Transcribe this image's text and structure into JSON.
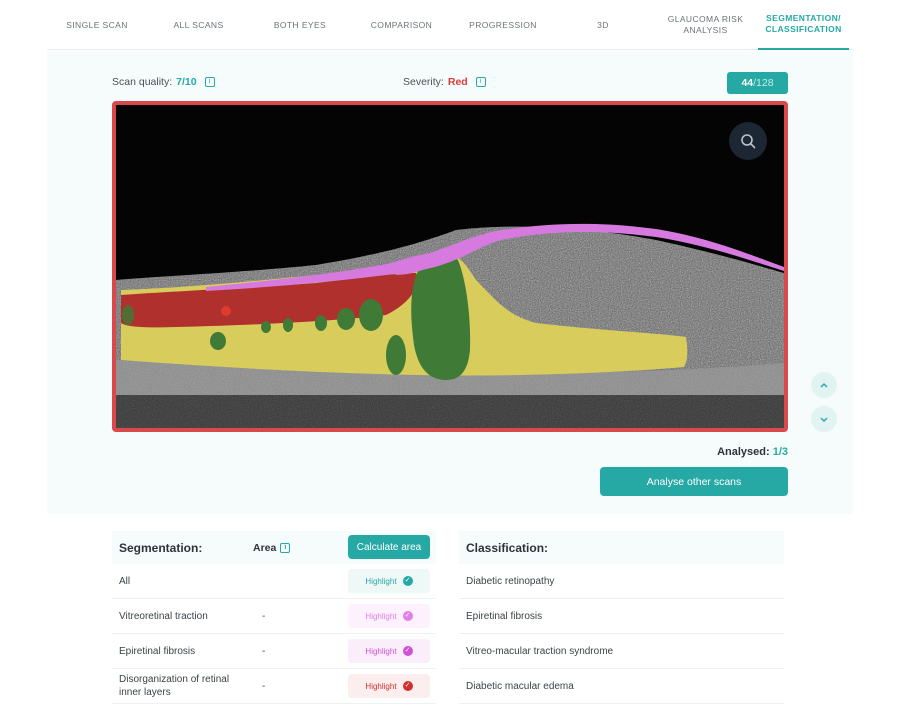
{
  "tabs": [
    {
      "label": "SINGLE SCAN",
      "active": false
    },
    {
      "label": "All SCANS",
      "active": false
    },
    {
      "label": "BOTH EYES",
      "active": false
    },
    {
      "label": "COMPARISON",
      "active": false
    },
    {
      "label": "PROGRESSION",
      "active": false
    },
    {
      "label": "3D",
      "active": false
    },
    {
      "label": "GLAUCOMA RISK ANALYSIS",
      "active": false
    },
    {
      "label": "SEGMENTATION/ CLASSIFICATION",
      "active": true
    }
  ],
  "scan": {
    "quality_label": "Scan quality:",
    "quality_value": "7/10",
    "severity_label": "Severity:",
    "severity_value": "Red",
    "current": "44",
    "total": "/128",
    "zoom_icon": "search-icon",
    "nav_up_icon": "chevron-up-icon",
    "nav_down_icon": "chevron-down-icon"
  },
  "analysis": {
    "analysed_label": "Analysed:",
    "analysed_value": "1/3",
    "button_label": "Analyse other scans"
  },
  "segmentation": {
    "title": "Segmentation:",
    "area_label": "Area",
    "calc_button": "Calculate area",
    "rows": [
      {
        "name": "All",
        "area": "",
        "highlight": "Highlight",
        "color": "#26a9a4",
        "bg": "#eef8f7"
      },
      {
        "name": "Vitreoretinal traction",
        "area": "-",
        "highlight": "Highlight",
        "color": "#e47ee8",
        "bg": "#fcf1fc"
      },
      {
        "name": "Epiretinal fibrosis",
        "area": "-",
        "highlight": "Highlight",
        "color": "#cf4fd6",
        "bg": "#fbeefb"
      },
      {
        "name": "Disorganization of retinal inner layers",
        "area": "-",
        "highlight": "Highlight",
        "color": "#d22f2f",
        "bg": "#fbeeee"
      }
    ]
  },
  "classification": {
    "title": "Classification:",
    "rows": [
      {
        "name": "Diabetic retinopathy"
      },
      {
        "name": "Epiretinal fibrosis"
      },
      {
        "name": "Vitreo-macular traction syndrome"
      },
      {
        "name": "Diabetic macular edema"
      }
    ]
  },
  "colors": {
    "accent": "#26a9a4",
    "severity_red": "#d93a3a",
    "frame_border": "#d9484b",
    "seg_yellow": "#d8cc5c",
    "seg_red": "#b0302e",
    "seg_green": "#3f7a36",
    "seg_magenta": "#d67ae0"
  }
}
